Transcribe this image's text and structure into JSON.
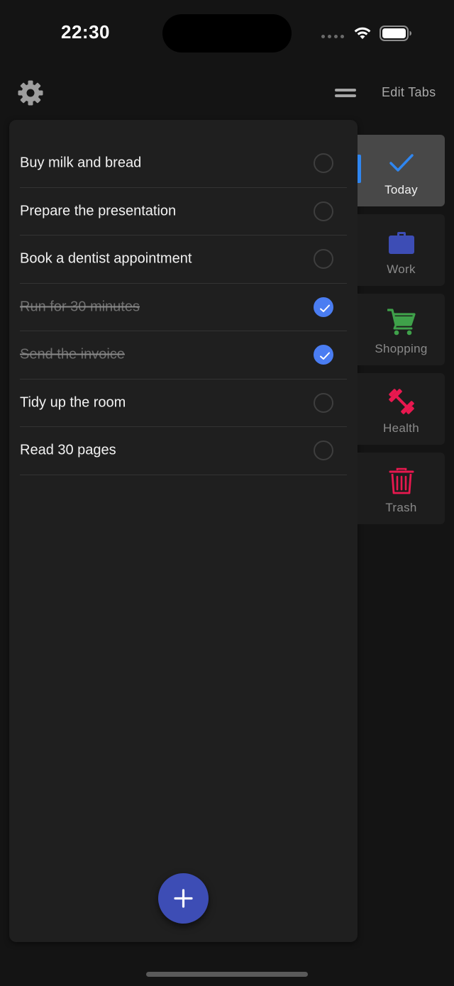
{
  "status_bar": {
    "time": "22:30"
  },
  "toolbar": {
    "settings_icon": "gear-icon",
    "menu_icon": "menu-icon",
    "edit_tabs_label": "Edit Tabs"
  },
  "todos": [
    {
      "text": "Buy milk and bread",
      "done": false
    },
    {
      "text": "Prepare the presentation",
      "done": false
    },
    {
      "text": "Book a dentist appointment",
      "done": false
    },
    {
      "text": "Run for 30 minutes",
      "done": true
    },
    {
      "text": "Send the invoice",
      "done": true
    },
    {
      "text": "Tidy up the room",
      "done": false
    },
    {
      "text": "Read 30 pages",
      "done": false
    }
  ],
  "fab": {
    "icon": "plus-icon"
  },
  "tabs": [
    {
      "label": "Today",
      "icon": "checkmark-icon",
      "color": "#2f86f0",
      "active": true
    },
    {
      "label": "Work",
      "icon": "briefcase-icon",
      "color": "#3d4db5",
      "active": false
    },
    {
      "label": "Shopping",
      "icon": "cart-icon",
      "color": "#3fa14a",
      "active": false
    },
    {
      "label": "Health",
      "icon": "dumbbell-icon",
      "color": "#e8184f",
      "active": false
    },
    {
      "label": "Trash",
      "icon": "trash-icon",
      "color": "#e8184f",
      "active": false
    }
  ],
  "colors": {
    "background": "#141414",
    "panel": "#1f1f1f",
    "checked": "#4a7df2",
    "fab": "#3d4db5"
  }
}
